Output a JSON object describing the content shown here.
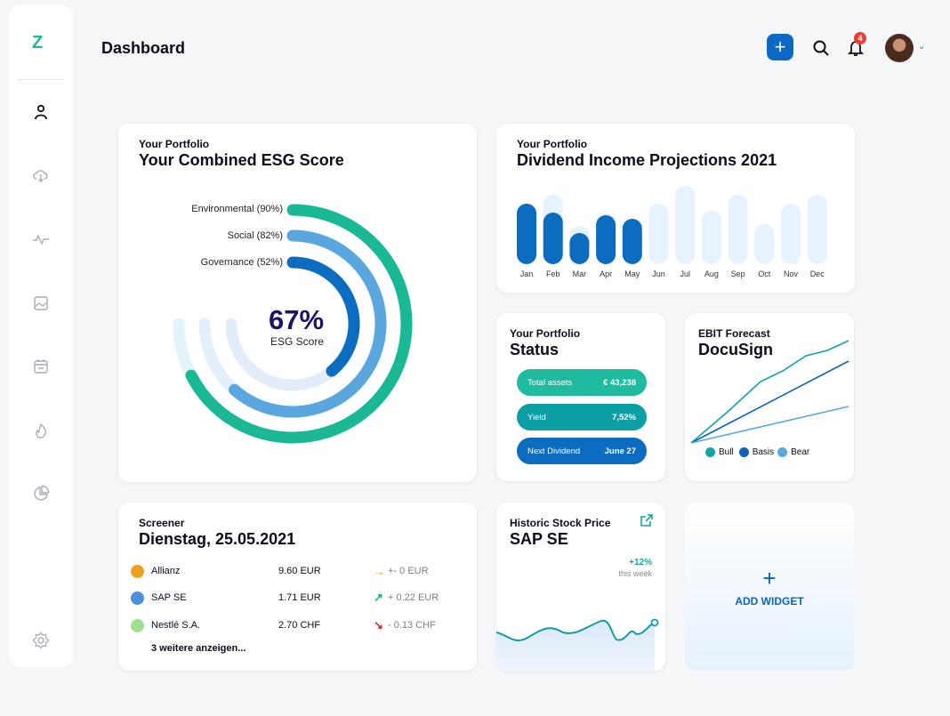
{
  "sidebar": {
    "logo": "Z",
    "items": [
      {
        "name": "user-icon",
        "label": ""
      },
      {
        "name": "cloud-download-icon",
        "label": ""
      },
      {
        "name": "activity-icon",
        "label": ""
      },
      {
        "name": "image-icon",
        "label": ""
      },
      {
        "name": "calendar-icon",
        "label": ""
      },
      {
        "name": "flame-icon",
        "label": ""
      },
      {
        "name": "pie-chart-icon",
        "label": ""
      },
      {
        "name": "settings-icon",
        "label": ""
      }
    ]
  },
  "header": {
    "title": "Dashboard",
    "add_label": "+",
    "notification_count": "4"
  },
  "esg": {
    "subtitle": "Your Portfolio",
    "title": "Your Combined ESG Score",
    "score": "67%",
    "score_label": "ESG Score",
    "rings": [
      {
        "label": "Environmental (90%)",
        "value": 90,
        "color": "#1ab894"
      },
      {
        "label": "Social (82%)",
        "value": 82,
        "color": "#5aa7df"
      },
      {
        "label": "Governance (52%)",
        "value": 52,
        "color": "#0b6cc0"
      }
    ]
  },
  "dividend": {
    "subtitle": "Your Portfolio",
    "title": "Dividend Income Projections 2021",
    "chart_data": {
      "type": "bar",
      "categories": [
        "Jan",
        "Feb",
        "Mar",
        "Apr",
        "May",
        "Jun",
        "Jul",
        "Aug",
        "Sep",
        "Oct",
        "Nov",
        "Dec"
      ],
      "series": [
        {
          "values": [
            68,
            78,
            43,
            58,
            51,
            68,
            88,
            60,
            78,
            45,
            68,
            78
          ]
        },
        {
          "values": [
            68,
            58,
            35,
            55,
            51,
            null,
            null,
            null,
            null,
            null,
            null,
            null
          ]
        }
      ],
      "ylim": [
        0,
        90
      ]
    }
  },
  "status": {
    "subtitle": "Your Portfolio",
    "title": "Status",
    "items": [
      {
        "label": "Total assets",
        "value": "€ 43,238",
        "color": "#1fbba0"
      },
      {
        "label": "Yield",
        "value": "7,52%",
        "color": "#0d9fa6"
      },
      {
        "label": "Next Dividend",
        "value": "June 27",
        "color": "#0b6cc0"
      }
    ]
  },
  "ebit": {
    "subtitle": "EBIT Forecast",
    "title": "DocuSign",
    "chart_data": {
      "type": "line",
      "series": [
        {
          "name": "Bull",
          "color": "#11a4a6"
        },
        {
          "name": "Basis",
          "color": "#0d63b5"
        },
        {
          "name": "Bear",
          "color": "#5aa7df"
        }
      ]
    }
  },
  "screener": {
    "subtitle": "Screener",
    "title": "Dienstag, 25.05.2021",
    "rows": [
      {
        "name": "Allianz",
        "value": "9.60 EUR",
        "arrow": "→",
        "change": "+- 0 EUR",
        "dot": "#f0a01e",
        "arrow_color": "#f0a01e"
      },
      {
        "name": "SAP SE",
        "value": "1.71 EUR",
        "arrow": "↗",
        "change": "+ 0.22 EUR",
        "dot": "#4a90dc",
        "arrow_color": "#1ab86a"
      },
      {
        "name": "Nestlé S.A.",
        "value": "2.70 CHF",
        "arrow": "↘",
        "change": "- 0.13 CHF",
        "dot": "#9fe08c",
        "arrow_color": "#d8282e"
      }
    ],
    "more": "3 weitere anzeigen..."
  },
  "stock": {
    "subtitle": "Historic Stock Price",
    "title": "SAP SE",
    "change": "+12%",
    "period": "this week"
  },
  "widget": {
    "plus": "+",
    "label": "ADD WIDGET"
  }
}
